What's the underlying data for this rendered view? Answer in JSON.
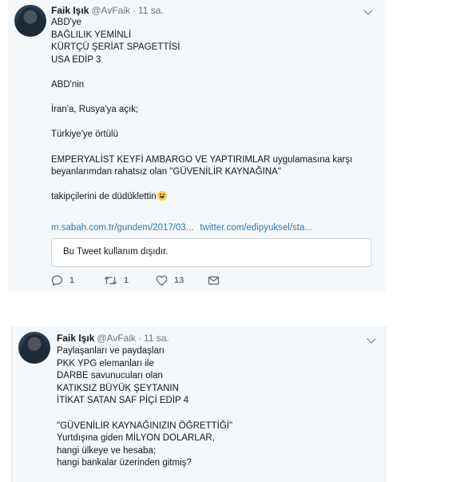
{
  "tweets": [
    {
      "author_name": "Faik Işık",
      "handle": "@AvFaik",
      "separator": "·",
      "time": "11 sa.",
      "lines": [
        "ABD'ye",
        "BAĞLILIK YEMİNLİ",
        "KÜRTÇÜ ŞERİAT SPAGETTİSİ",
        "USA EDİP 3",
        "",
        "ABD'nin",
        "",
        "İran'a, Rusya'ya açık;",
        "",
        "Türkiye'ye örtülü",
        "",
        "EMPERYALİST KEYFİ AMBARGO VE YAPTIRIMLAR uygulamasına karşı",
        "beyanlarımdan rahatsız olan \"GÜVENİLİR KAYNAĞINA\"",
        "",
        "takipçilerini de düdüklettin"
      ],
      "links": [
        "m.sabah.com.tr/gundem/2017/03...",
        "twitter.com/edipyuksel/sta..."
      ],
      "card_text": "Bu Tweet kullanım dışıdır.",
      "reply_count": "1",
      "retweet_count": "1",
      "like_count": "13",
      "icons": {
        "avatar": "profile-photo",
        "caret": "chevron-down-icon",
        "reply": "reply-icon",
        "retweet": "retweet-icon",
        "like": "heart-icon",
        "dm": "envelope-icon",
        "emoji": "grinning-face-emoji"
      }
    },
    {
      "author_name": "Faik Işık",
      "handle": "@AvFaik",
      "separator": "·",
      "time": "11 sa.",
      "lines": [
        "Paylaşanları ve paydaşları",
        "PKK YPG elemanları ile",
        "DARBE savunucuları olan",
        "KATIKSIZ BÜYÜK ŞEYTANIN",
        "İTİKAT SATAN SAF PİÇİ EDİP 4",
        "",
        "\"GÜVENİLİR KAYNAĞINIZIN ÖĞRETTİĞİ\"",
        "Yurtdışına giden MİLYON DOLARLAR,",
        "hangi ülkeye ve hesaba;",
        "hangi bankalar üzerinden gitmiş?"
      ]
    }
  ],
  "colors": {
    "tweet_background": "#f5f8fa",
    "link": "#2b7bb9",
    "secondary_text": "#657786",
    "primary_text": "#14171a",
    "card_border": "#ccd6dd"
  }
}
